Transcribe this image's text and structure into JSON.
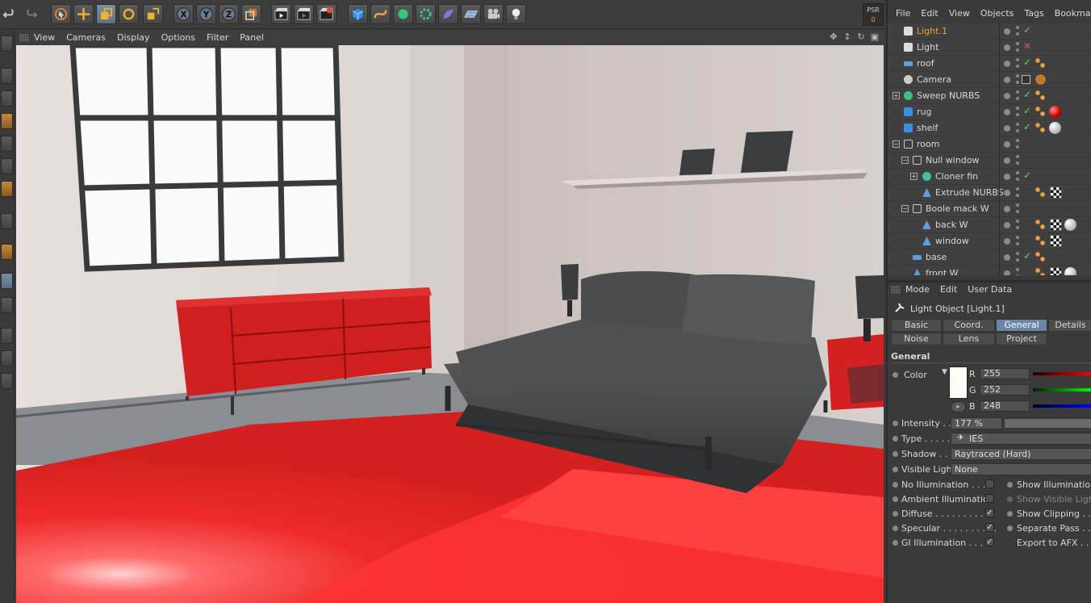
{
  "viewport_menu": [
    "View",
    "Cameras",
    "Display",
    "Options",
    "Filter",
    "Panel"
  ],
  "psr": {
    "label": "PSR",
    "value": "0"
  },
  "toolbar_icons": [
    "undo-icon",
    "redo-icon",
    "live-selection-icon",
    "move-icon",
    "scale-icon",
    "rotate-icon",
    "last-tool-icon",
    "x-axis-icon",
    "y-axis-icon",
    "z-axis-icon",
    "coordinate-system-icon",
    "render-view-icon",
    "render-picture-viewer-icon",
    "render-settings-icon",
    "cube-icon",
    "spline-icon",
    "nurbs-icon",
    "array-icon",
    "deformer-icon",
    "scene-icon",
    "camera-icon",
    "light-icon"
  ],
  "object_manager": {
    "menu": [
      "File",
      "Edit",
      "View",
      "Objects",
      "Tags",
      "Bookmarks"
    ],
    "rows": [
      {
        "name": "Light.1",
        "selected": true,
        "icon": "light-icon"
      },
      {
        "name": "Light",
        "icon": "light-icon"
      },
      {
        "name": "roof",
        "icon": "plane-icon"
      },
      {
        "name": "Camera",
        "icon": "camera-icon"
      },
      {
        "name": "Sweep NURBS",
        "icon": "sweep-icon"
      },
      {
        "name": "rug",
        "icon": "cube-icon"
      },
      {
        "name": "shelf",
        "icon": "cube-icon"
      },
      {
        "name": "room",
        "icon": "null-icon"
      },
      {
        "name": "Null window",
        "icon": "null-icon"
      },
      {
        "name": "Cloner fin",
        "icon": "cloner-icon"
      },
      {
        "name": "Extrude NURBS",
        "icon": "extrude-icon"
      },
      {
        "name": "Boole mack W",
        "icon": "null-icon"
      },
      {
        "name": "back W",
        "icon": "polygon-icon"
      },
      {
        "name": "window",
        "icon": "polygon-icon"
      },
      {
        "name": "base",
        "icon": "plane-icon"
      },
      {
        "name": "front W",
        "icon": "polygon-icon"
      }
    ]
  },
  "attribute_manager": {
    "menu": [
      "Mode",
      "Edit",
      "User Data"
    ],
    "title": "Light Object [Light.1]",
    "tabs_row1": [
      "Basic",
      "Coord.",
      "General",
      "Details"
    ],
    "tabs_row2": [
      "Noise",
      "Lens",
      "Project"
    ],
    "active_tab": "General",
    "section": "General",
    "color": {
      "label": "Color",
      "r_label": "R",
      "g_label": "G",
      "b_label": "B",
      "r": "255",
      "g": "252",
      "b": "248",
      "swatch": "#fffcf8"
    },
    "intensity": {
      "label": "Intensity . .",
      "value": "177 %"
    },
    "type": {
      "label": "Type . . . . .",
      "value": "IES"
    },
    "shadow": {
      "label": "Shadow . . .",
      "value": "Raytraced (Hard)"
    },
    "visible_light": {
      "label": "Visible Light",
      "value": "None"
    },
    "checks_left": [
      {
        "label": "No Illumination . . . .",
        "checked": false
      },
      {
        "label": "Ambient Illumination",
        "checked": false
      },
      {
        "label": "Diffuse . . . . . . . . . . .",
        "checked": true
      },
      {
        "label": "Specular . . . . . . . . . .",
        "checked": true
      },
      {
        "label": "GI Illumination . . . . .",
        "checked": true
      }
    ],
    "checks_right": [
      "Show Illumination",
      "Show Visible Light",
      "Show Clipping . . .",
      "Separate Pass . . .",
      "Export to AFX . . ."
    ]
  },
  "colors": {
    "accent": "#6c86a6",
    "selected_text": "#f0a030",
    "floor": "#ff2a2a",
    "dresser": "#d42020"
  }
}
